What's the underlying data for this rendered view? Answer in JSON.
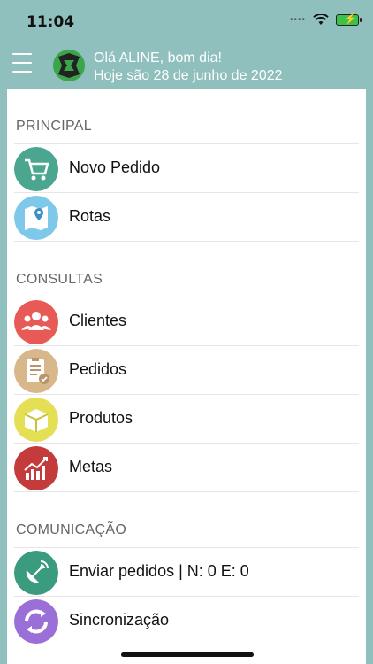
{
  "status": {
    "time": "11:04"
  },
  "header": {
    "line1": "Olá ALINE, bom dia!",
    "line2": "Hoje são 28 de junho de 2022"
  },
  "sections": [
    {
      "title": "PRINCIPAL",
      "items": [
        {
          "label": "Novo Pedido",
          "color": "#4ba68f",
          "icon": "cart-icon"
        },
        {
          "label": "Rotas",
          "color": "#7ec8ea",
          "icon": "map-icon"
        }
      ]
    },
    {
      "title": "CONSULTAS",
      "items": [
        {
          "label": "Clientes",
          "color": "#e85a55",
          "icon": "users-icon"
        },
        {
          "label": "Pedidos",
          "color": "#d8b88a",
          "icon": "clipboard-icon"
        },
        {
          "label": "Produtos",
          "color": "#e5df55",
          "icon": "box-icon"
        },
        {
          "label": "Metas",
          "color": "#c43b3b",
          "icon": "chart-icon"
        }
      ]
    },
    {
      "title": "COMUNICAÇÃO",
      "items": [
        {
          "label": "Enviar pedidos | N: 0  E: 0",
          "color": "#3a9b7f",
          "icon": "satellite-icon"
        },
        {
          "label": "Sincronização",
          "color": "#9b6fd8",
          "icon": "sync-icon"
        }
      ]
    }
  ]
}
